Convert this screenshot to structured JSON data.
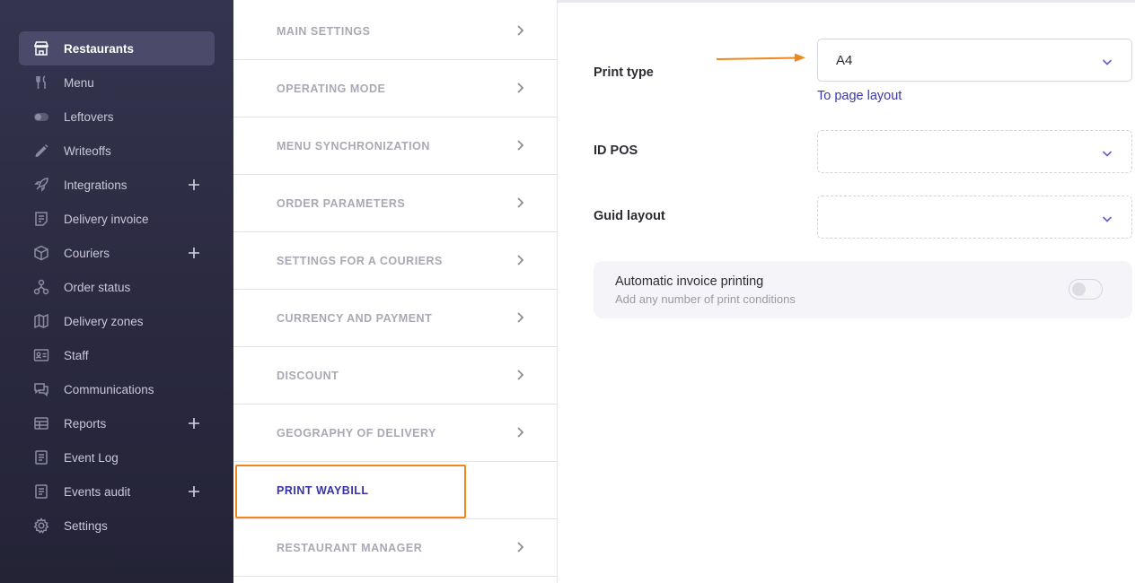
{
  "sidebar": {
    "items": [
      {
        "label": "Restaurants",
        "icon": "store-icon",
        "active": true
      },
      {
        "label": "Menu",
        "icon": "cutlery-icon"
      },
      {
        "label": "Leftovers",
        "icon": "toggle-icon"
      },
      {
        "label": "Writeoffs",
        "icon": "pencil-icon"
      },
      {
        "label": "Integrations",
        "icon": "rocket-icon",
        "expandable": true
      },
      {
        "label": "Delivery invoice",
        "icon": "invoice-icon"
      },
      {
        "label": "Couriers",
        "icon": "box-icon",
        "expandable": true
      },
      {
        "label": "Order status",
        "icon": "flow-icon"
      },
      {
        "label": "Delivery zones",
        "icon": "map-icon"
      },
      {
        "label": "Staff",
        "icon": "id-card-icon"
      },
      {
        "label": "Communications",
        "icon": "chat-icon"
      },
      {
        "label": "Reports",
        "icon": "table-icon",
        "expandable": true
      },
      {
        "label": "Event Log",
        "icon": "log-icon"
      },
      {
        "label": "Events audit",
        "icon": "audit-icon",
        "expandable": true
      },
      {
        "label": "Settings",
        "icon": "gear-icon"
      }
    ]
  },
  "settings_menu": {
    "items": [
      {
        "label": "MAIN SETTINGS"
      },
      {
        "label": "OPERATING MODE"
      },
      {
        "label": "MENU SYNCHRONIZATION"
      },
      {
        "label": "ORDER PARAMETERS"
      },
      {
        "label": "SETTINGS FOR A COURIERS"
      },
      {
        "label": "CURRENCY AND PAYMENT"
      },
      {
        "label": "DISCOUNT"
      },
      {
        "label": "GEOGRAPHY OF DELIVERY"
      },
      {
        "label": "PRINT WAYBILL",
        "active": true
      },
      {
        "label": "RESTAURANT MANAGER"
      }
    ]
  },
  "form": {
    "print_type_label": "Print type",
    "print_type_value": "A4",
    "page_layout_link": "To page layout",
    "id_pos_label": "ID POS",
    "id_pos_value": "",
    "guid_layout_label": "Guid layout",
    "guid_layout_value": ""
  },
  "auto_printing": {
    "title": "Automatic invoice printing",
    "subtitle": "Add any number of print conditions",
    "enabled": false
  },
  "colors": {
    "sidebar_bg": "#2e2d45",
    "accent": "#3733a6",
    "highlight": "#f0871d"
  }
}
